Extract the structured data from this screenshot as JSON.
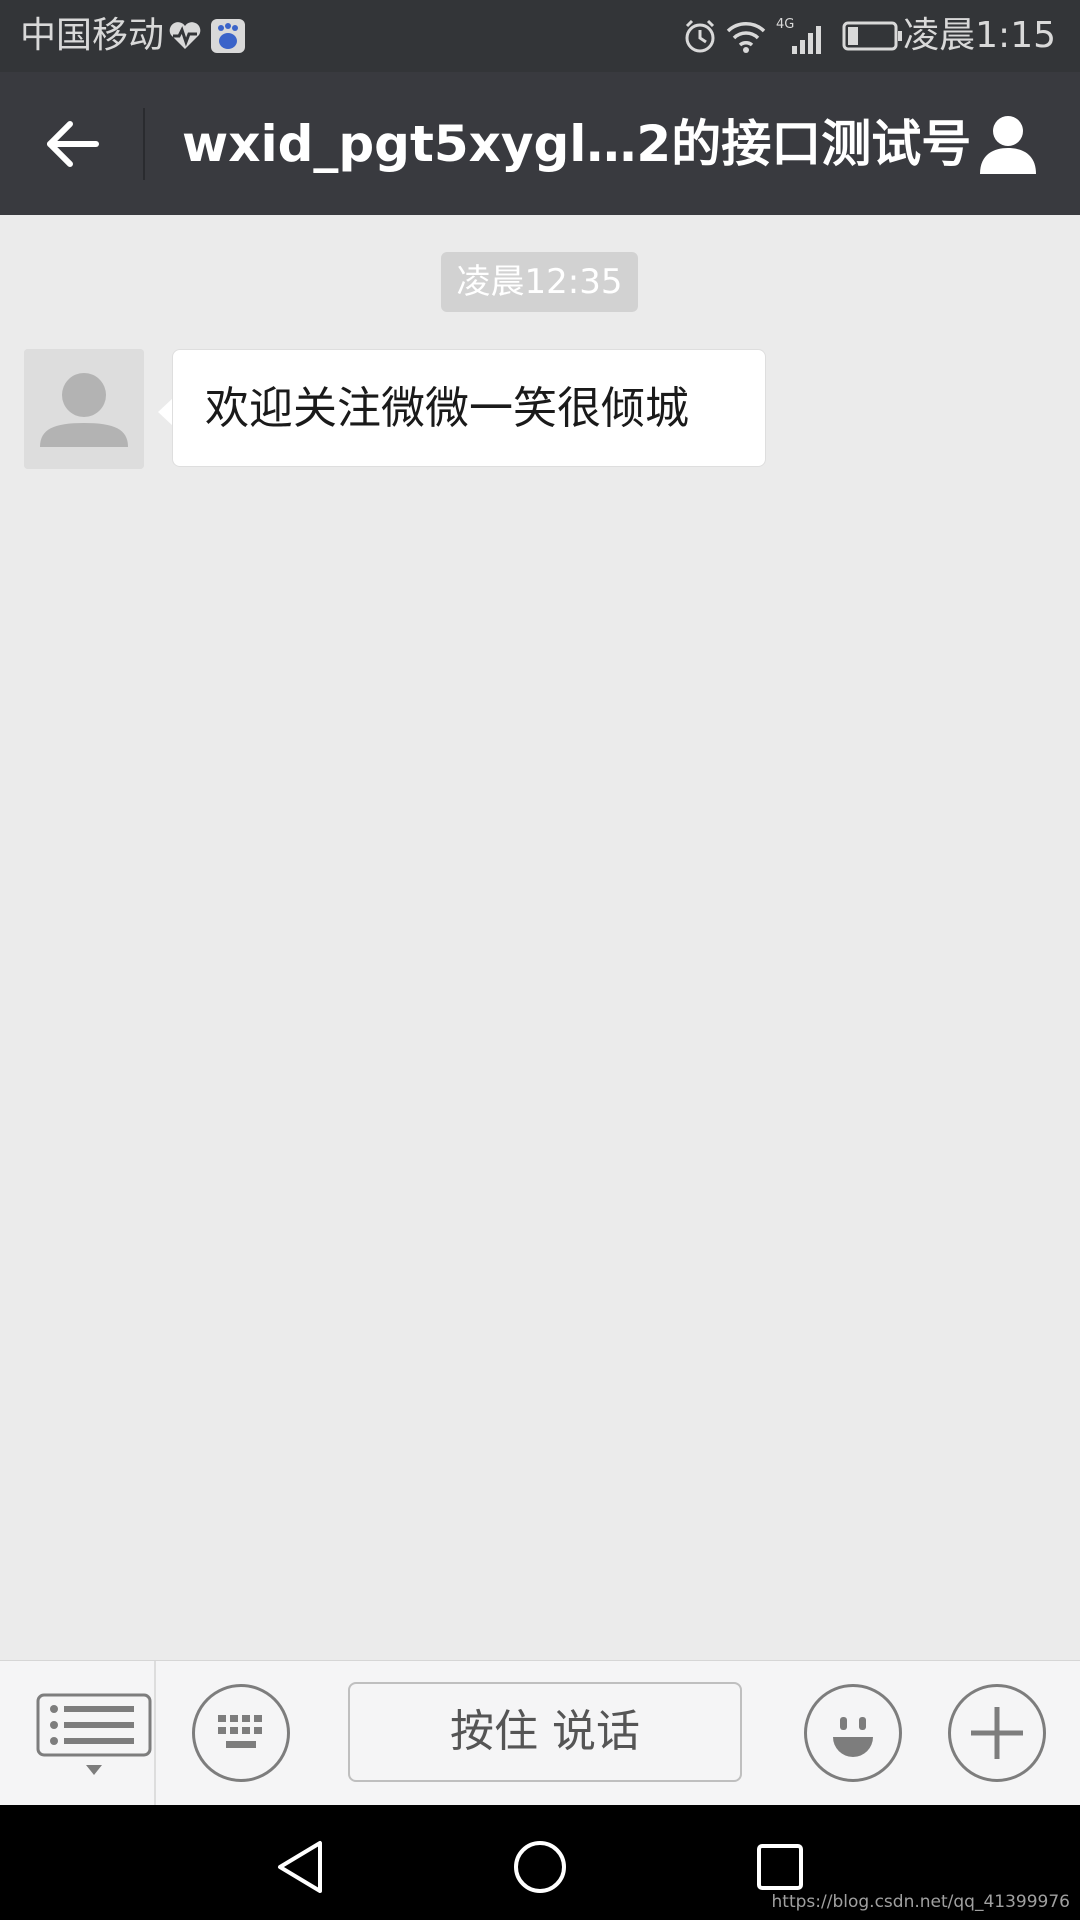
{
  "status_bar": {
    "carrier": "中国移动",
    "network": "4G",
    "time": "凌晨1:15"
  },
  "header": {
    "title": "wxid_pgt5xygl…2的接口测试号",
    "icons": [
      "back-arrow-icon",
      "profile-icon"
    ]
  },
  "chat": {
    "timestamp": "凌晨12:35",
    "messages": [
      {
        "sender": "other",
        "text": "欢迎关注微微一笑很倾城"
      }
    ]
  },
  "input_bar": {
    "hold_to_talk_label": "按住 说话",
    "icons": [
      "menu-list-icon",
      "keyboard-icon",
      "emoji-icon",
      "plus-icon"
    ]
  },
  "watermark": "https://blog.csdn.net/qq_41399976",
  "colors": {
    "header_bg": "#393a3f",
    "status_bar_bg": "#333538",
    "chat_bg": "#ebebeb",
    "bubble_bg": "#ffffff"
  }
}
